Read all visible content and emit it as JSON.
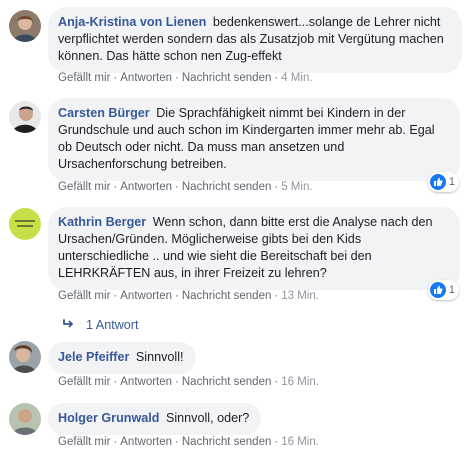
{
  "actions": {
    "like": "Gefällt mir",
    "reply": "Antworten",
    "message": "Nachricht senden",
    "separator": "·"
  },
  "comments": [
    {
      "author": "Anja-Kristina von Lienen",
      "text": "bedenkenswert...solange de Lehrer nicht verpflichtet werden sondern das als Zusatzjob mit Vergütung machen können. Das hätte schon nen Zug-effekt",
      "time": "4 Min.",
      "avatar_icon": "profile-photo"
    },
    {
      "author": "Carsten Bürger",
      "text": "Die Sprachfähigkeit nimmt bei Kindern in der Grundschule und auch schon im Kindergarten immer mehr ab. Egal ob Deutsch oder nicht. Da muss man ansetzen und Ursachenforschung betreiben.",
      "time": "5 Min.",
      "reaction_count": "1",
      "avatar_icon": "profile-photo"
    },
    {
      "author": "Kathrin Berger",
      "text": "Wenn schon, dann bitte erst die Analyse nach den Ursachen/Gründen. Möglicherweise gibts bei den Kids unterschiedliche .. und wie sieht die Bereitschaft bei den LEHRKRÄFTEN aus, in ihrer Freizeit zu lehren?",
      "time": "13 Min.",
      "reaction_count": "1",
      "avatar_icon": "profile-photo"
    },
    {
      "author": "Jele Pfeiffer",
      "text": "Sinnvoll!",
      "time": "16 Min.",
      "avatar_icon": "profile-photo"
    },
    {
      "author": "Holger Grunwald",
      "text": "Sinnvoll, oder?",
      "time": "16 Min.",
      "avatar_icon": "profile-photo"
    }
  ],
  "replies": {
    "label": "1 Antwort",
    "icon": "reply-arrow-icon"
  },
  "colors": {
    "name": "#385898",
    "bubble": "#f2f3f5",
    "meta": "#616770",
    "like": "#1877f2"
  }
}
